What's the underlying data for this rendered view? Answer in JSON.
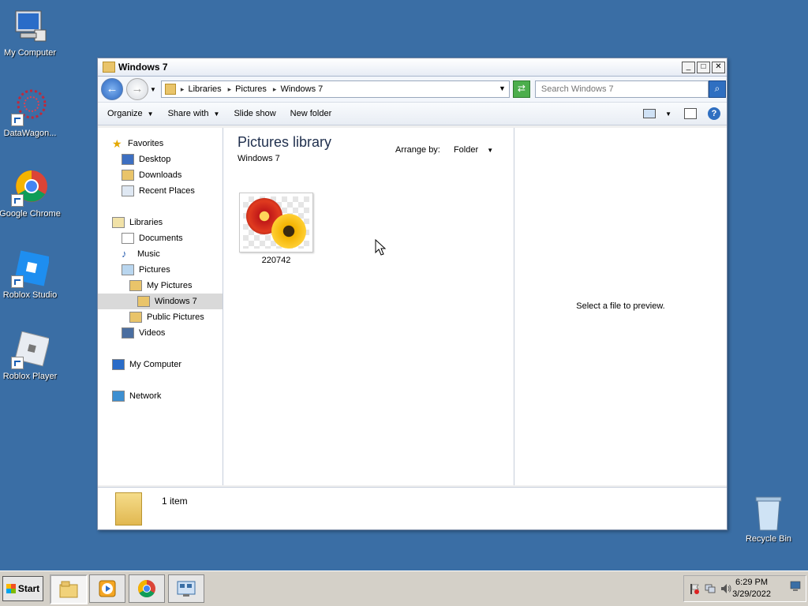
{
  "desktop": {
    "icons": [
      {
        "label": "My Computer"
      },
      {
        "label": "DataWagon..."
      },
      {
        "label": "Google Chrome"
      },
      {
        "label": "Roblox Studio"
      },
      {
        "label": "Roblox Player"
      },
      {
        "label": "Recycle Bin"
      }
    ]
  },
  "window": {
    "title": "Windows 7",
    "breadcrumbs": [
      "Libraries",
      "Pictures",
      "Windows 7"
    ],
    "search_placeholder": "Search Windows 7",
    "commands": {
      "organize": "Organize",
      "share_with": "Share with",
      "slide_show": "Slide show",
      "new_folder": "New folder"
    },
    "nav": {
      "favorites": "Favorites",
      "desktop": "Desktop",
      "downloads": "Downloads",
      "recent_places": "Recent Places",
      "libraries": "Libraries",
      "documents": "Documents",
      "music": "Music",
      "pictures": "Pictures",
      "my_pictures": "My Pictures",
      "windows7": "Windows 7",
      "public_pictures": "Public Pictures",
      "videos": "Videos",
      "my_computer": "My Computer",
      "network": "Network"
    },
    "library": {
      "title": "Pictures library",
      "subtitle": "Windows 7",
      "arrange_label": "Arrange by:",
      "arrange_value": "Folder"
    },
    "files": [
      {
        "name": "220742"
      }
    ],
    "preview_msg": "Select a file to preview.",
    "item_count": "1 item"
  },
  "taskbar": {
    "start_label": "Start",
    "time": "6:29 PM",
    "date": "3/29/2022"
  }
}
